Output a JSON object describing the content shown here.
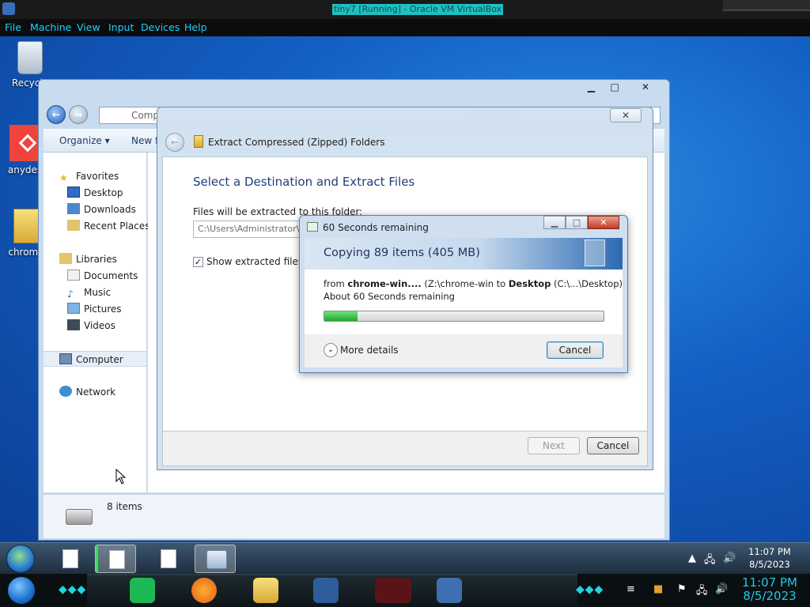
{
  "host": {
    "window_title": "tiny7 [Running] - Oracle VM VirtualBox",
    "menu": [
      "File",
      "Machine",
      "View",
      "Input",
      "Devices",
      "Help"
    ],
    "clock_time": "11:07 PM",
    "clock_date": "8/5/2023"
  },
  "desktop": {
    "icons": [
      {
        "label": "Recycle",
        "icon": "recycle-bin-icon"
      },
      {
        "label": "anydesk",
        "icon": "anydesk-icon"
      },
      {
        "label": "chrome",
        "icon": "zip-folder-icon"
      }
    ]
  },
  "explorer": {
    "address": "Comp",
    "toolbar": {
      "organize": "Organize ▾",
      "new_folder": "New fo"
    },
    "nav": {
      "favorites": "Favorites",
      "desktop": "Desktop",
      "downloads": "Downloads",
      "recent": "Recent Places",
      "libraries": "Libraries",
      "documents": "Documents",
      "music": "Music",
      "pictures": "Pictures",
      "videos": "Videos",
      "computer": "Computer",
      "network": "Network"
    },
    "status": "8 items"
  },
  "wizard": {
    "title": "Extract Compressed (Zipped) Folders",
    "heading": "Select a Destination and Extract Files",
    "folder_label": "Files will be extracted to this folder:",
    "folder_value": "C:\\Users\\Administrator\\",
    "show_label": "Show extracted files wh",
    "show_checked": true,
    "next_label": "Next",
    "cancel_label": "Cancel"
  },
  "copy_dialog": {
    "title": "60 Seconds remaining",
    "header": "Copying 89 items (405 MB)",
    "from_prefix": "from ",
    "source_name": "chrome-win....",
    "source_path": " (Z:\\chrome-win to ",
    "dest_name": "Desktop",
    "dest_path": " (C:\\...\\Desktop)",
    "remaining": "About 60 Seconds remaining",
    "progress_percent": 12,
    "more_details": "More details",
    "cancel_label": "Cancel"
  },
  "taskbar": {
    "clock_time": "11:07 PM",
    "clock_date": "8/5/2023"
  },
  "colors": {
    "progress": "#2fb83d",
    "accent": "#1e3f7a"
  }
}
